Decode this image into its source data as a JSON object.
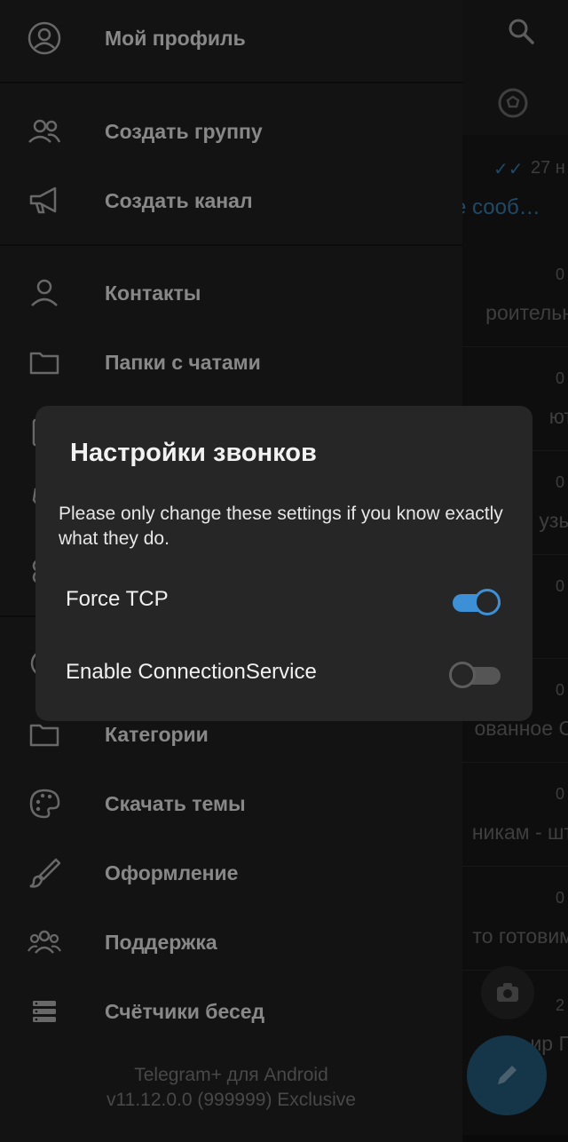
{
  "background": {
    "read_receipt": "✓✓",
    "date": "27 н",
    "blue_snippet": "е сооб…",
    "rows": [
      {
        "time": "0",
        "snippet": "роительн"
      },
      {
        "time": "0",
        "snippet": "ют"
      },
      {
        "time": "0",
        "snippet": "узы"
      },
      {
        "time": "0",
        "snippet": ""
      },
      {
        "time": "0",
        "snippet": "ованное С"
      },
      {
        "time": "0",
        "snippet": "никам - шт"
      },
      {
        "time": "0",
        "snippet": "то готовим"
      },
      {
        "time": "2",
        "snippet": "ир П"
      }
    ]
  },
  "drawer": {
    "profile": "Мой профиль",
    "items_group1": [
      "Создать группу",
      "Создать канал"
    ],
    "items_group2": [
      "Контакты",
      "Папки с чатами"
    ],
    "items_group3": [
      "Категории",
      "Скачать темы",
      "Оформление",
      "Поддержка",
      "Счётчики бесед"
    ],
    "footer_line1": "Telegram+ для Android",
    "footer_line2": "v11.12.0.0 (999999) Exclusive"
  },
  "dialog": {
    "title": "Настройки звонков",
    "description": "Please only change these settings if you know exactly what they do.",
    "settings": [
      {
        "label": "Force TCP",
        "enabled": true
      },
      {
        "label": "Enable ConnectionService",
        "enabled": false
      }
    ]
  },
  "colors": {
    "accent": "#3d8fd6",
    "drawer_bg": "#1c1c1c",
    "dialog_bg": "#262626"
  }
}
